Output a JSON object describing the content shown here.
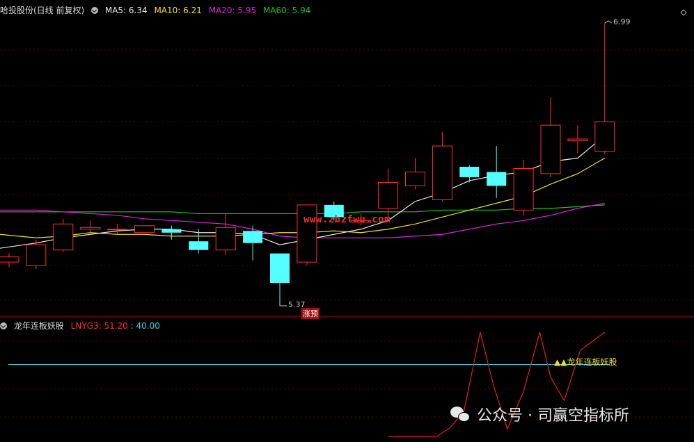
{
  "price_header": {
    "title": "哈投股份(日线 前复权)",
    "ma5_label": "MA5: 6.34",
    "ma10_label": "MA10: 6.21",
    "ma20_label": "MA20: 5.95",
    "ma60_label": "MA60: 5.94",
    "colors": {
      "ma5": "#e8e8e8",
      "ma10": "#f0e020",
      "ma20": "#e020e0",
      "ma60": "#20c020"
    }
  },
  "indicator_header": {
    "title": "龙年连板妖股",
    "series_label": "LNYG3: 51.20",
    "level_label": ": 40.00"
  },
  "annotations": {
    "high_label": "6.99",
    "low_label": "5.37",
    "limit_up_tag": "涨预",
    "signal_label": "龙年连板妖股",
    "watermark": "www.zbzfwu.com"
  },
  "footer": {
    "text": "公众号 · 司赢空指标所",
    "icon": "wechat-icon"
  },
  "chart_data": {
    "type": "candlestick",
    "candles": [
      {
        "o": 5.61,
        "c": 5.64,
        "h": 5.66,
        "l": 5.58
      },
      {
        "o": 5.59,
        "c": 5.71,
        "h": 5.74,
        "l": 5.57
      },
      {
        "o": 5.68,
        "c": 5.83,
        "h": 5.86,
        "l": 5.67
      },
      {
        "o": 5.8,
        "c": 5.81,
        "h": 5.85,
        "l": 5.77
      },
      {
        "o": 5.8,
        "c": 5.8,
        "h": 5.83,
        "l": 5.77
      },
      {
        "o": 5.78,
        "c": 5.82,
        "h": 5.82,
        "l": 5.78
      },
      {
        "o": 5.8,
        "c": 5.78,
        "h": 5.82,
        "l": 5.74
      },
      {
        "o": 5.73,
        "c": 5.68,
        "h": 5.8,
        "l": 5.66
      },
      {
        "o": 5.68,
        "c": 5.81,
        "h": 5.89,
        "l": 5.65
      },
      {
        "o": 5.79,
        "c": 5.72,
        "h": 5.82,
        "l": 5.62
      },
      {
        "o": 5.66,
        "c": 5.49,
        "h": 5.66,
        "l": 5.37
      },
      {
        "o": 5.61,
        "c": 5.94,
        "h": 5.94,
        "l": 5.59
      },
      {
        "o": 5.94,
        "c": 5.87,
        "h": 5.96,
        "l": 5.85
      },
      {
        "o": 5.84,
        "c": 5.85,
        "h": 5.89,
        "l": 5.82
      },
      {
        "o": 5.92,
        "c": 6.07,
        "h": 6.15,
        "l": 5.87
      },
      {
        "o": 6.05,
        "c": 6.13,
        "h": 6.21,
        "l": 6.03
      },
      {
        "o": 5.97,
        "c": 6.28,
        "h": 6.36,
        "l": 5.96
      },
      {
        "o": 6.16,
        "c": 6.1,
        "h": 6.17,
        "l": 6.07
      },
      {
        "o": 6.13,
        "c": 6.05,
        "h": 6.28,
        "l": 5.98
      },
      {
        "o": 5.91,
        "c": 6.15,
        "h": 6.2,
        "l": 5.88
      },
      {
        "o": 6.12,
        "c": 6.4,
        "h": 6.56,
        "l": 6.1
      },
      {
        "o": 6.31,
        "c": 6.32,
        "h": 6.4,
        "l": 6.24
      },
      {
        "o": 6.25,
        "c": 6.42,
        "h": 6.99,
        "l": 6.23
      }
    ],
    "ma5": [
      5.69,
      5.72,
      5.75,
      5.77,
      5.79,
      5.8,
      5.8,
      5.78,
      5.78,
      5.77,
      5.71,
      5.74,
      5.77,
      5.8,
      5.85,
      5.96,
      6.01,
      6.08,
      6.11,
      6.13,
      6.19,
      6.21,
      6.34
    ],
    "ma10": [
      5.77,
      5.75,
      5.76,
      5.78,
      5.77,
      5.77,
      5.76,
      5.76,
      5.76,
      5.77,
      5.78,
      5.78,
      5.79,
      5.78,
      5.8,
      5.83,
      5.87,
      5.91,
      5.95,
      5.99,
      6.06,
      6.12,
      6.21
    ],
    "ma20": [
      5.91,
      5.91,
      5.9,
      5.89,
      5.88,
      5.86,
      5.85,
      5.84,
      5.83,
      5.8,
      5.76,
      5.75,
      5.75,
      5.75,
      5.75,
      5.76,
      5.77,
      5.8,
      5.83,
      5.85,
      5.88,
      5.92,
      5.95
    ],
    "ma60": [
      5.9,
      5.9,
      5.9,
      5.9,
      5.9,
      5.9,
      5.9,
      5.89,
      5.89,
      5.89,
      5.89,
      5.89,
      5.89,
      5.9,
      5.9,
      5.9,
      5.91,
      5.91,
      5.91,
      5.92,
      5.92,
      5.93,
      5.94
    ],
    "indicator_series": {
      "x": [
        14,
        14.7,
        15.3,
        15.8,
        16.3,
        16.8,
        17.4,
        17.9,
        18.4,
        19,
        19.6,
        20.0,
        20.5,
        21.1,
        22
      ],
      "values": [
        0,
        0,
        0,
        0,
        5,
        14,
        58,
        28,
        4,
        25,
        58,
        33,
        20,
        48,
        58
      ]
    },
    "indicator_level": 40.0
  }
}
